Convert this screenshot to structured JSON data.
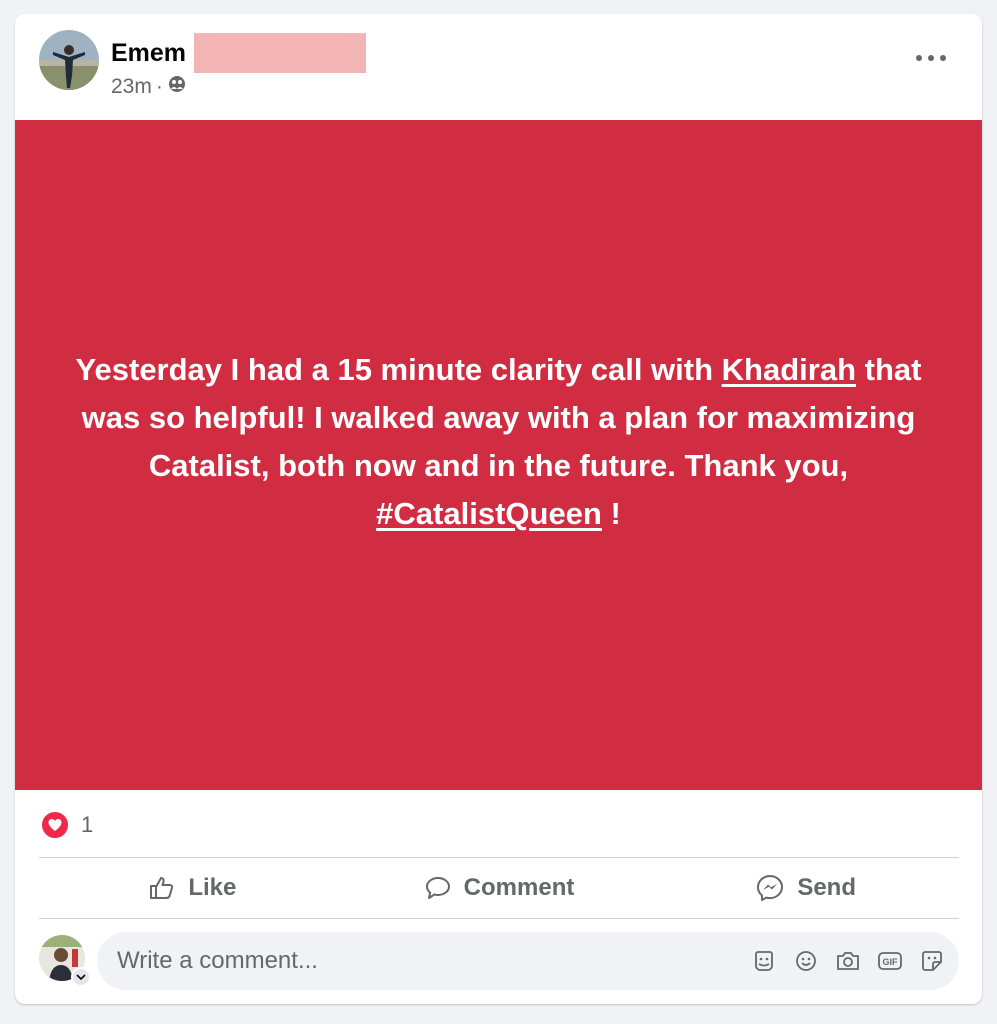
{
  "post": {
    "author_name": "Emem",
    "time": "23m",
    "separator": "·",
    "privacy_icon": "friends-icon",
    "more_icon": "more-horizontal-icon",
    "text_part1": "Yesterday I had a 15 minute clarity call with ",
    "mention": "Khadirah",
    "text_part2": " that was so helpful! I walked away with a plan for maximizing Catalist, both now and in the future. Thank you, ",
    "hashtag": "#CatalistQueen",
    "text_part3": " !",
    "background_color": "#d12d42"
  },
  "reactions": {
    "icon": "love-icon",
    "count": "1"
  },
  "actions": {
    "like": "Like",
    "comment": "Comment",
    "send": "Send"
  },
  "comment": {
    "placeholder": "Write a comment...",
    "icons": [
      "avatar-sticker-icon",
      "emoji-icon",
      "camera-icon",
      "gif-icon",
      "sticker-icon"
    ]
  }
}
